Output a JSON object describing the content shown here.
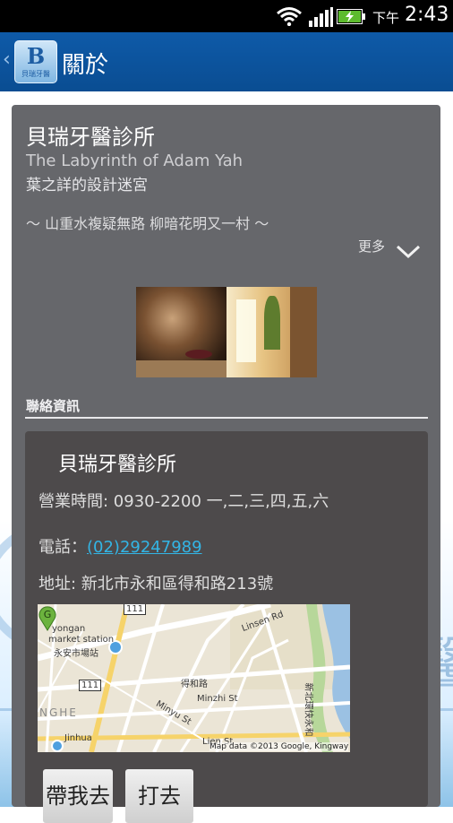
{
  "status_bar": {
    "ampm": "下午",
    "time": "2:43",
    "icons": [
      "wifi-icon",
      "signal-icon",
      "battery-charging-icon"
    ]
  },
  "action_bar": {
    "back_glyph": "‹",
    "logo_text": "B",
    "logo_subtext": "貝瑞牙醫",
    "title": "關於"
  },
  "background": {
    "watermark_text": "牙醫"
  },
  "about": {
    "clinic_name": "貝瑞牙醫診所",
    "subtitle_en": "The Labyrinth of Adam Yah",
    "subtitle_zh": "葉之詳的設計迷宮",
    "motto": "～ 山重水複疑無路  柳暗花明又一村 ～",
    "more_label": "更多"
  },
  "contact": {
    "section_label": "聯絡資訊",
    "name": "貝瑞牙醫診所",
    "hours": "營業時間: 0930-2200 一,二,三,四,五,六",
    "phone_prefix": "電話：",
    "phone": "(02)29247989",
    "address": "地址: 新北市永和區得和路213號"
  },
  "map": {
    "pin_label": "G",
    "labels": {
      "yongan": "yongan",
      "market_station": "market station",
      "station_zh": "永安市場站",
      "route_111_top": "111",
      "route_111_left": "111",
      "linsen": "Linsen Rd",
      "dehe": "得和路",
      "minzhi": "Minzhi St",
      "minyu": "Minyu St",
      "lien": "Lien St",
      "expressway": "新北環快永和",
      "nghe": "NGHE",
      "jinhua": "Jinhua"
    },
    "credit": "Map data ©2013 Google, Kingway"
  },
  "buttons": {
    "navigate": "帶我去",
    "call": "打去"
  },
  "colors": {
    "action_bar": "#0e5aa8",
    "card": "#66676b",
    "contact_card": "#4d4a4b",
    "link": "#33b5e5"
  }
}
